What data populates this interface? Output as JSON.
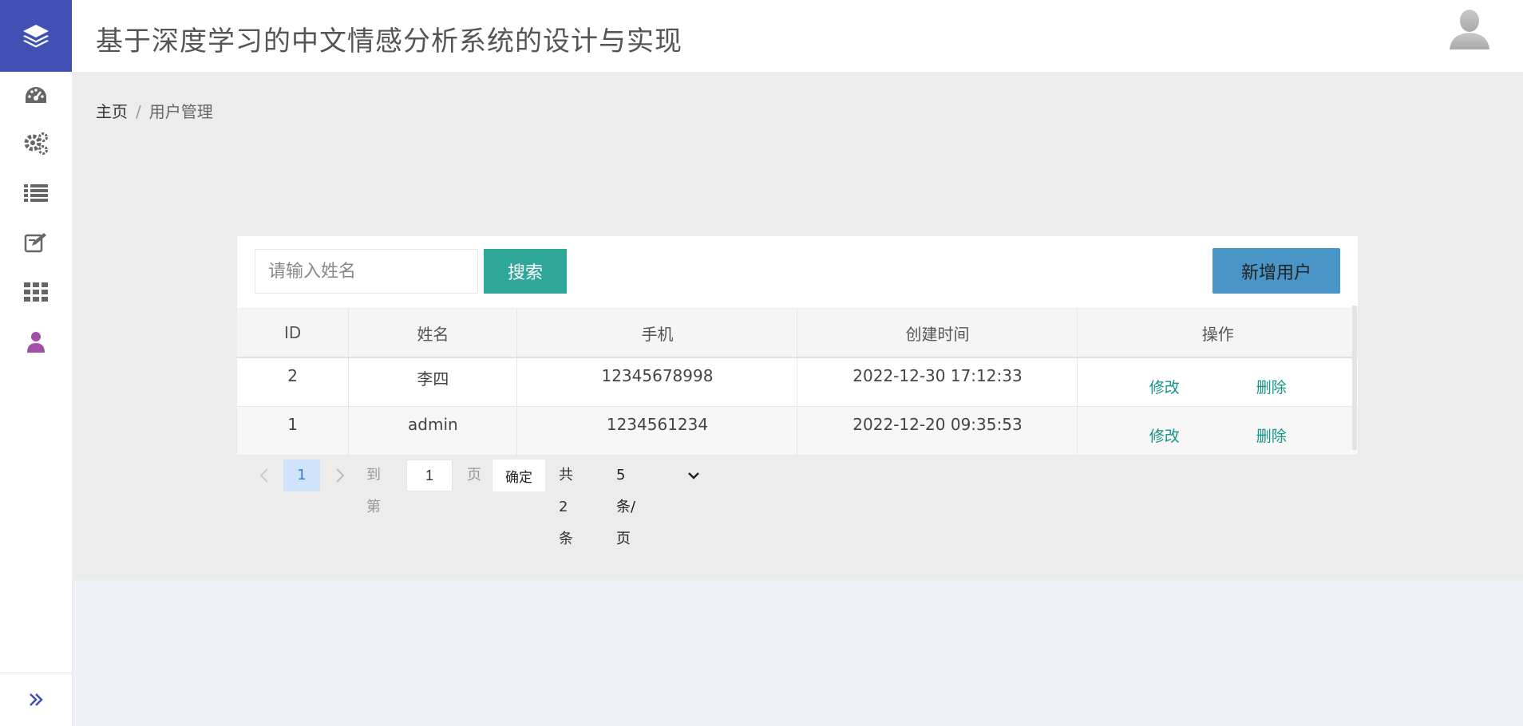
{
  "header": {
    "title": "基于深度学习的中文情感分析系统的设计与实现"
  },
  "sidebar": {
    "items": [
      {
        "icon": "dashboard-icon"
      },
      {
        "icon": "gears-icon"
      },
      {
        "icon": "list-icon"
      },
      {
        "icon": "edit-icon"
      },
      {
        "icon": "grid-icon"
      },
      {
        "icon": "user-icon",
        "active": true
      }
    ],
    "active_color": "#a24fa9",
    "icon_color": "#666666"
  },
  "breadcrumb": {
    "home": "主页",
    "separator": "/",
    "current": "用户管理"
  },
  "search": {
    "placeholder": "请输入姓名",
    "value": "",
    "button_label": "搜索"
  },
  "add_button_label": "新增用户",
  "table": {
    "columns": [
      "ID",
      "姓名",
      "手机",
      "创建时间",
      "操作"
    ],
    "rows": [
      {
        "id": "2",
        "name": "李四",
        "phone": "12345678998",
        "created": "2022-12-30 17:12:33",
        "edit": "修改",
        "delete": "删除"
      },
      {
        "id": "1",
        "name": "admin",
        "phone": "1234561234",
        "created": "2022-12-20 09:35:53",
        "edit": "修改",
        "delete": "删除"
      }
    ]
  },
  "pagination": {
    "prev": "‹",
    "current_page": "1",
    "next": "›",
    "goto_label": "到第",
    "goto_value": "1",
    "page_label": "页",
    "confirm_label": "确定",
    "total": "共 2 条",
    "page_size": "5 条/页"
  },
  "colors": {
    "brand": "#4350b3",
    "search_button": "#2fa89a",
    "add_button": "#4a95c8",
    "link": "#139488"
  }
}
